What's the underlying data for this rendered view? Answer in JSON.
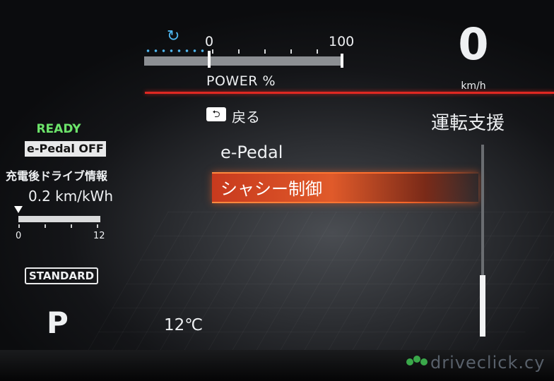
{
  "power_gauge": {
    "regen_icon": "regen-arrows-icon",
    "min_label": "0",
    "max_label": "100",
    "label": "POWER %",
    "level_percent": 0
  },
  "speed": {
    "value": "0",
    "unit": "km/h"
  },
  "menu": {
    "back_icon": "back-arrow-icon",
    "back_label": "戻る",
    "title": "運転支援",
    "items": [
      {
        "label": "e-Pedal",
        "selected": false
      },
      {
        "label": "シャシー制御",
        "selected": true
      }
    ]
  },
  "status": {
    "ready": "READY",
    "epedal": "e-Pedal OFF",
    "charge_info_label": "充電後ドライブ情報",
    "efficiency": "0.2 km/kWh",
    "scale_min": "0",
    "scale_max": "12",
    "drive_mode": "STANDARD",
    "gear": "P"
  },
  "ambient": {
    "temperature": "12℃"
  },
  "watermark": {
    "text": "driveclick.cy"
  },
  "colors": {
    "accent_red": "#e02822",
    "ready_green": "#6ce36a",
    "regen_blue": "#4fb7f0",
    "highlight_orange": "#e05a2a"
  }
}
